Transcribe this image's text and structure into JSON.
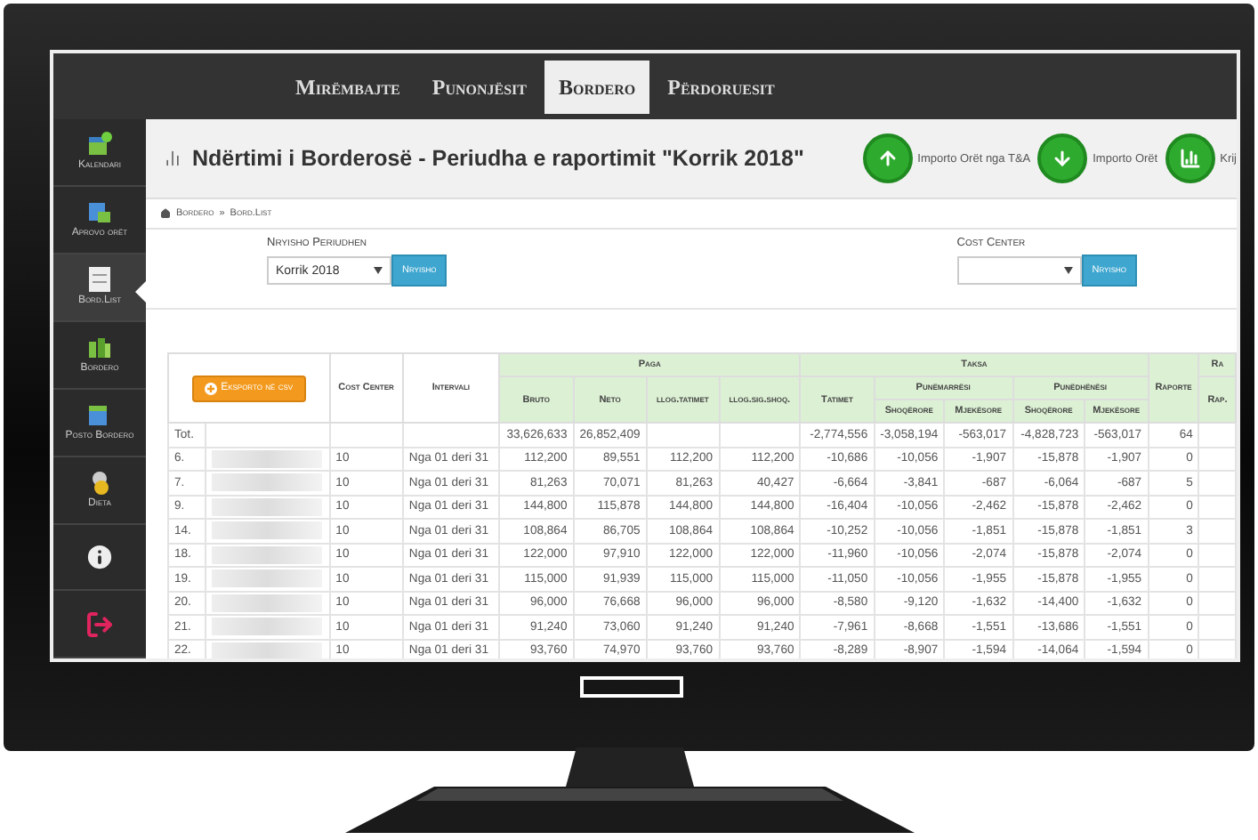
{
  "navbar": {
    "items": [
      {
        "label": "Mirëmbajte",
        "selected": false
      },
      {
        "label": "Punonjësit",
        "selected": false
      },
      {
        "label": "Bordero",
        "selected": true
      },
      {
        "label": "Përdoruesit",
        "selected": false
      }
    ]
  },
  "sidebar": {
    "items": [
      {
        "label": "Kalendari",
        "kind": "calendar",
        "selected": false
      },
      {
        "label": "Aprovo orët",
        "kind": "approve",
        "selected": false
      },
      {
        "label": "Bord.List",
        "kind": "list",
        "selected": true
      },
      {
        "label": "Bordero",
        "kind": "people",
        "selected": false
      },
      {
        "label": "Posto Bordero",
        "kind": "post",
        "selected": false
      },
      {
        "label": "Dieta",
        "kind": "money",
        "selected": false
      },
      {
        "kind": "info",
        "selected": false
      },
      {
        "kind": "logout",
        "selected": false
      }
    ]
  },
  "page_title": "Ndërtimi i Borderosë - Periudha e raportimit \"Korrik 2018\"",
  "actions": [
    {
      "label": "Importo Orët nga T&A",
      "kind": "upload"
    },
    {
      "label": "Importo Orët",
      "kind": "download"
    },
    {
      "label": "Krij",
      "kind": "chart"
    }
  ],
  "breadcrumb": [
    "Bordero",
    "»",
    "Bord.List"
  ],
  "filters": [
    {
      "label": "Nryisho Periudhen",
      "value": "Korrik 2018",
      "button": "Nryisho"
    },
    {
      "label": "Cost Center",
      "button": "Nryisho"
    }
  ],
  "table": {
    "columns": [
      {
        "kind": "export",
        "button": "Eksporto në csv",
        "colspan": 2
      },
      {
        "label": "Cost Center"
      },
      {
        "label": "Intervali"
      },
      {
        "label": "Paga",
        "colspan": 4,
        "children": [
          {
            "label": "Bruto"
          },
          {
            "label": "Neto"
          },
          {
            "label": "llog.tatimet"
          },
          {
            "label": "llog.sig.shoq."
          }
        ]
      },
      {
        "label": "Taksa",
        "colspan": 5,
        "children": [
          {
            "label": "Tatimet"
          },
          {
            "label": "Punëmarrësi",
            "colspan": 2,
            "children": [
              {
                "label": "Shoqërore"
              },
              {
                "label": "Mjekësore"
              }
            ]
          },
          {
            "label": "Punëdhënësi",
            "colspan": 2,
            "children": [
              {
                "label": "Shoqërore"
              },
              {
                "label": "Mjekësore"
              }
            ]
          }
        ]
      },
      {
        "label": "Raporte"
      },
      {
        "label": "Ra",
        "children": [
          {
            "label": "Rap."
          }
        ]
      }
    ],
    "total": {
      "cells": [
        "Tot.",
        null,
        null,
        null,
        "33,626,633",
        "26,852,409",
        null,
        null,
        "-2,774,556",
        "-3,058,194",
        "-563,017",
        "-4,828,723",
        "-563,017",
        "64",
        null
      ]
    },
    "rows": [
      {
        "cells": [
          "6.",
          null,
          "10",
          "Nga 01 deri 31",
          "112,200",
          "89,551",
          "112,200",
          "112,200",
          "-10,686",
          "-10,056",
          "-1,907",
          "-15,878",
          "-1,907",
          "0",
          null
        ]
      },
      {
        "cells": [
          "7.",
          null,
          "10",
          "Nga 01 deri 31",
          "81,263",
          "70,071",
          "81,263",
          "40,427",
          "-6,664",
          "-3,841",
          "-687",
          "-6,064",
          "-687",
          "5",
          null
        ]
      },
      {
        "cells": [
          "9.",
          null,
          "10",
          "Nga 01 deri 31",
          "144,800",
          "115,878",
          "144,800",
          "144,800",
          "-16,404",
          "-10,056",
          "-2,462",
          "-15,878",
          "-2,462",
          "0",
          null
        ]
      },
      {
        "cells": [
          "14.",
          null,
          "10",
          "Nga 01 deri 31",
          "108,864",
          "86,705",
          "108,864",
          "108,864",
          "-10,252",
          "-10,056",
          "-1,851",
          "-15,878",
          "-1,851",
          "3",
          null
        ]
      },
      {
        "cells": [
          "18.",
          null,
          "10",
          "Nga 01 deri 31",
          "122,000",
          "97,910",
          "122,000",
          "122,000",
          "-11,960",
          "-10,056",
          "-2,074",
          "-15,878",
          "-2,074",
          "0",
          null
        ]
      },
      {
        "cells": [
          "19.",
          null,
          "10",
          "Nga 01 deri 31",
          "115,000",
          "91,939",
          "115,000",
          "115,000",
          "-11,050",
          "-10,056",
          "-1,955",
          "-15,878",
          "-1,955",
          "0",
          null
        ]
      },
      {
        "cells": [
          "20.",
          null,
          "10",
          "Nga 01 deri 31",
          "96,000",
          "76,668",
          "96,000",
          "96,000",
          "-8,580",
          "-9,120",
          "-1,632",
          "-14,400",
          "-1,632",
          "0",
          null
        ]
      },
      {
        "cells": [
          "21.",
          null,
          "10",
          "Nga 01 deri 31",
          "91,240",
          "73,060",
          "91,240",
          "91,240",
          "-7,961",
          "-8,668",
          "-1,551",
          "-13,686",
          "-1,551",
          "0",
          null
        ]
      },
      {
        "cells": [
          "22.",
          null,
          "10",
          "Nga 01 deri 31",
          "93,760",
          "74,970",
          "93,760",
          "93,760",
          "-8,289",
          "-8,907",
          "-1,594",
          "-14,064",
          "-1,594",
          "0",
          null
        ]
      }
    ]
  }
}
